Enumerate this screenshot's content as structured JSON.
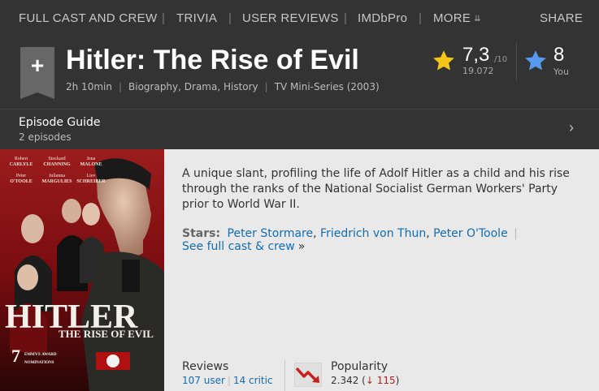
{
  "nav": {
    "items": [
      "FULL CAST AND CREW",
      "TRIVIA",
      "USER REVIEWS",
      "IMDbPro",
      "MORE"
    ],
    "share": "SHARE"
  },
  "title": {
    "watchlist_icon": "plus-icon",
    "name": "Hitler: The Rise of Evil",
    "runtime": "2h 10min",
    "genres": "Biography, Drama, History",
    "type_year": "TV Mini-Series (2003)"
  },
  "rating": {
    "value": "7,3",
    "max": "/10",
    "count": "19.072",
    "your_rating": "8",
    "your_label": "You",
    "star_color": "#f5c518",
    "your_star_color": "#5799ef"
  },
  "episodes": {
    "title": "Episode Guide",
    "count": "2 episodes"
  },
  "poster": {
    "credits_top": [
      {
        "first": "Robert",
        "last": "CARLYLE"
      },
      {
        "first": "Stockard",
        "last": "CHANNING"
      },
      {
        "first": "Jena",
        "last": "MALONE"
      }
    ],
    "credits_bottom": [
      {
        "first": "Peter",
        "last": "O'TOOLE"
      },
      {
        "first": "Julianna",
        "last": "MARGULIES"
      },
      {
        "first": "Liev",
        "last": "SCHREIBER"
      }
    ],
    "title": "HITLER",
    "subtitle": "THE RISE OF EVIL",
    "award_number": "7",
    "award_line1": "EMMY® AWARD",
    "award_line2": "NOMINATIONS"
  },
  "plot": "A unique slant, profiling the life of Adolf Hitler as a child and his rise through the ranks of the National Socialist German Workers' Party prior to World War II.",
  "stars": {
    "label": "Stars:",
    "names": [
      "Peter Stormare",
      "Friedrich von Thun",
      "Peter O'Toole"
    ],
    "full_cast": "See full cast & crew",
    "raquo": "»"
  },
  "reviews": {
    "title": "Reviews",
    "user": "107 user",
    "critic": "14 critic"
  },
  "popularity": {
    "title": "Popularity",
    "rank": "2.342",
    "change": "115",
    "trend_icon": "trend-down-icon"
  }
}
